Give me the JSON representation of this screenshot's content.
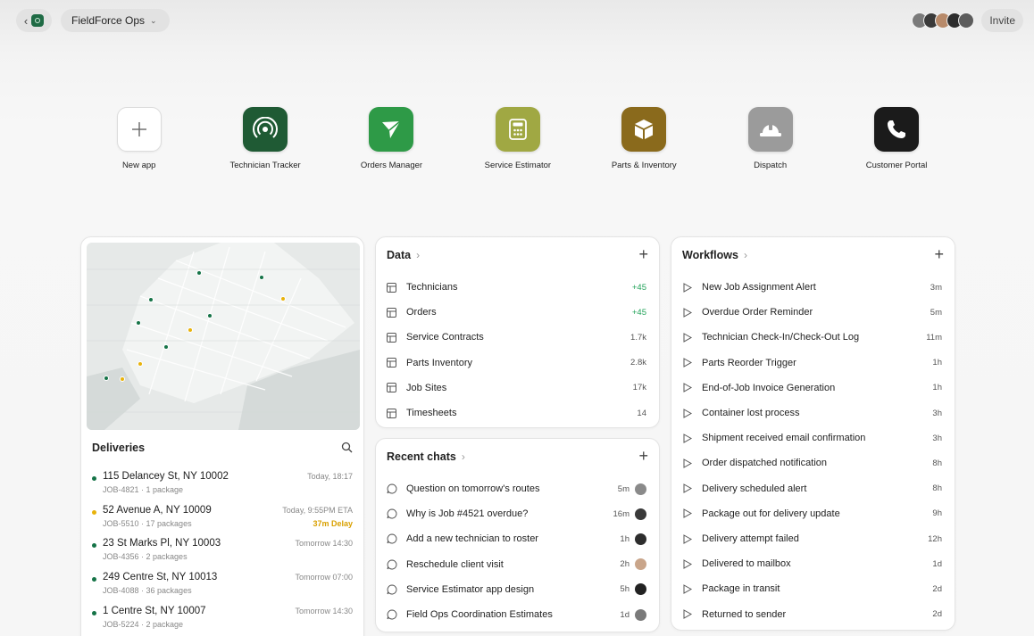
{
  "topbar": {
    "workspace": "FieldForce Ops",
    "invite_label": "Invite",
    "avatar_colors": [
      "#7a7a7a",
      "#3a3a3a",
      "#b88a6a",
      "#2d2d2d",
      "#5c5c5c"
    ]
  },
  "apps": [
    {
      "label": "New app",
      "color": "#ffffff",
      "icon": "plus-icon"
    },
    {
      "label": "Technician Tracker",
      "color": "#1f5a34",
      "icon": "signal-icon"
    },
    {
      "label": "Orders Manager",
      "color": "#2e9a47",
      "icon": "send-icon"
    },
    {
      "label": "Service Estimator",
      "color": "#a0a843",
      "icon": "calculator-icon"
    },
    {
      "label": "Parts & Inventory",
      "color": "#8a6a1c",
      "icon": "box-icon"
    },
    {
      "label": "Dispatch",
      "color": "#9b9b9b",
      "icon": "hardhat-icon"
    },
    {
      "label": "Customer Portal",
      "color": "#1b1b1b",
      "icon": "phone-icon"
    }
  ],
  "deliveries": {
    "title": "Deliveries",
    "items": [
      {
        "address": "115 Delancey St, NY 10002",
        "job": "JOB-4821",
        "packages": "1 package",
        "time": "Today, 18:17",
        "delay": "",
        "status_color": "#157347"
      },
      {
        "address": "52 Avenue A, NY 10009",
        "job": "JOB-5510",
        "packages": "17 packages",
        "time": "Today, 9:55PM ETA",
        "delay": "37m Delay",
        "status_color": "#e8b20b"
      },
      {
        "address": "23 St Marks Pl, NY 10003",
        "job": "JOB-4356",
        "packages": "2 packages",
        "time": "Tomorrow 14:30",
        "delay": "",
        "status_color": "#157347"
      },
      {
        "address": "249 Centre St, NY 10013",
        "job": "JOB-4088",
        "packages": "36 packages",
        "time": "Tomorrow 07:00",
        "delay": "",
        "status_color": "#157347"
      },
      {
        "address": "1 Centre St, NY 10007",
        "job": "JOB-5224",
        "packages": "2 package",
        "time": "Tomorrow 14:30",
        "delay": "",
        "status_color": "#157347"
      }
    ]
  },
  "data_card": {
    "title": "Data",
    "items": [
      {
        "label": "Technicians",
        "value": "+45",
        "positive": true
      },
      {
        "label": "Orders",
        "value": "+45",
        "positive": true
      },
      {
        "label": "Service Contracts",
        "value": "1.7k",
        "positive": false
      },
      {
        "label": "Parts Inventory",
        "value": "2.8k",
        "positive": false
      },
      {
        "label": "Job Sites",
        "value": "17k",
        "positive": false
      },
      {
        "label": "Timesheets",
        "value": "14",
        "positive": false
      }
    ]
  },
  "chats_card": {
    "title": "Recent chats",
    "items": [
      {
        "label": "Question on tomorrow's routes",
        "time": "5m",
        "avatar": "#8a8a8a"
      },
      {
        "label": "Why is Job #4521 overdue?",
        "time": "16m",
        "avatar": "#3a3a3a"
      },
      {
        "label": "Add a new technician to roster",
        "time": "1h",
        "avatar": "#2d2d2d"
      },
      {
        "label": "Reschedule client visit",
        "time": "2h",
        "avatar": "#c9a58a"
      },
      {
        "label": "Service Estimator app design",
        "time": "5h",
        "avatar": "#222222"
      },
      {
        "label": "Field Ops Coordination Estimates",
        "time": "1d",
        "avatar": "#7a7a7a"
      }
    ]
  },
  "workflows_card": {
    "title": "Workflows",
    "items": [
      {
        "label": "New Job Assignment Alert",
        "time": "3m"
      },
      {
        "label": "Overdue Order Reminder",
        "time": "5m"
      },
      {
        "label": "Technician Check-In/Check-Out Log",
        "time": "11m"
      },
      {
        "label": "Parts Reorder Trigger",
        "time": "1h"
      },
      {
        "label": "End-of-Job Invoice Generation",
        "time": "1h"
      },
      {
        "label": "Container lost process",
        "time": "3h"
      },
      {
        "label": "Shipment received email confirmation",
        "time": "3h"
      },
      {
        "label": "Order dispatched notification",
        "time": "8h"
      },
      {
        "label": "Delivery scheduled alert",
        "time": "8h"
      },
      {
        "label": "Package out for delivery update",
        "time": "9h"
      },
      {
        "label": "Delivery attempt failed",
        "time": "12h"
      },
      {
        "label": "Delivered to mailbox",
        "time": "1d"
      },
      {
        "label": "Package in transit",
        "time": "2d"
      },
      {
        "label": "Returned to sender",
        "time": "2d"
      }
    ]
  },
  "map_pins": [
    {
      "status": "delivered"
    },
    {
      "status": "delivered"
    },
    {
      "status": "delayed"
    },
    {
      "status": "delivered"
    },
    {
      "status": "delivered"
    },
    {
      "status": "delivered"
    },
    {
      "status": "delayed"
    },
    {
      "status": "delivered"
    },
    {
      "status": "delayed"
    },
    {
      "status": "delivered"
    },
    {
      "status": "delayed"
    }
  ]
}
